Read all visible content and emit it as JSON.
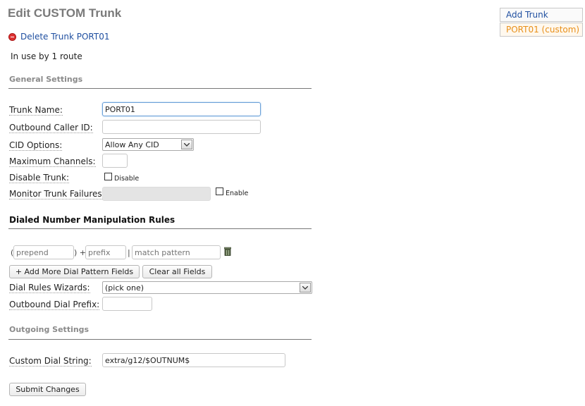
{
  "page": {
    "title": "Edit CUSTOM Trunk",
    "delete_link": "Delete Trunk PORT01",
    "in_use": "In use by 1 route"
  },
  "sidebar": {
    "items": [
      {
        "label": "Add Trunk",
        "color": "#1f4fa0"
      },
      {
        "label": "PORT01 (custom)",
        "color": "#e8901a"
      }
    ]
  },
  "general": {
    "heading": "General Settings",
    "trunk_name_label": "Trunk Name:",
    "trunk_name_value": "PORT01",
    "outbound_cid_label": "Outbound Caller ID:",
    "outbound_cid_value": "",
    "cid_options_label": "CID Options:",
    "cid_options_value": "Allow Any CID",
    "max_channels_label": "Maximum Channels:",
    "max_channels_value": "",
    "disable_trunk_label": "Disable Trunk:",
    "disable_text": "Disable",
    "monitor_label": "Monitor Trunk Failures:",
    "enable_text": "Enable"
  },
  "dial_rules": {
    "heading": "Dialed Number Manipulation Rules",
    "prepend_placeholder": "prepend",
    "prefix_placeholder": "prefix",
    "match_placeholder": "match pattern",
    "open_paren": "(",
    "close_paren_plus": ") +",
    "pipe": "|",
    "add_more_button": "+ Add More Dial Pattern Fields",
    "clear_all_button": "Clear all Fields",
    "wizards_label": "Dial Rules Wizards:",
    "wizards_value": "(pick one)",
    "outbound_prefix_label": "Outbound Dial Prefix:",
    "outbound_prefix_value": ""
  },
  "outgoing": {
    "heading": "Outgoing Settings",
    "custom_dial_label": "Custom Dial String:",
    "custom_dial_value": "extra/g12/$OUTNUM$"
  },
  "submit_button": "Submit Changes",
  "colors": {
    "link_blue": "#1f4fa0",
    "active_orange": "#e8901a",
    "delete_red": "#dd3333",
    "focus_border": "#6aa0d8"
  }
}
